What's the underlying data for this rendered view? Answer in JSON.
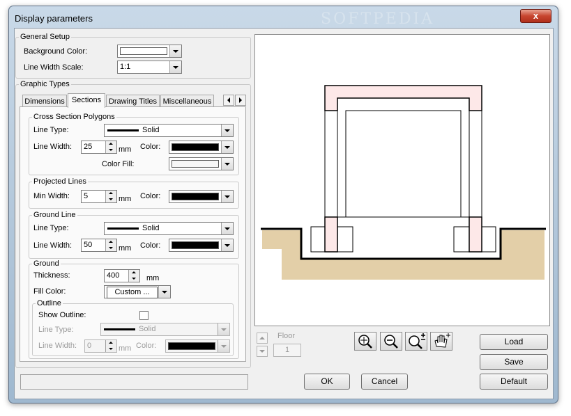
{
  "window": {
    "title": "Display parameters",
    "watermark": "SOFTPEDIA",
    "close_glyph": "x"
  },
  "general_setup": {
    "legend": "General Setup",
    "background_color_label": "Background Color:",
    "background_color_value": "#ffffff",
    "line_width_scale_label": "Line Width Scale:",
    "line_width_scale_value": "1:1"
  },
  "graphic_types": {
    "legend": "Graphic Types",
    "tabs": [
      {
        "label": "Dimensions"
      },
      {
        "label": "Sections",
        "active": true
      },
      {
        "label": "Drawing Titles"
      },
      {
        "label": "Miscellaneous"
      }
    ]
  },
  "cross_section": {
    "legend": "Cross Section Polygons",
    "line_type_label": "Line Type:",
    "line_type_value": "Solid",
    "line_width_label": "Line Width:",
    "line_width_value": "25",
    "unit": "mm",
    "color_label": "Color:",
    "color_value": "#000000",
    "color_fill_label": "Color Fill:",
    "color_fill_value": "#f7f7f7"
  },
  "projected_lines": {
    "legend": "Projected Lines",
    "min_width_label": "Min Width:",
    "min_width_value": "5",
    "unit": "mm",
    "color_label": "Color:",
    "color_value": "#000000"
  },
  "ground_line": {
    "legend": "Ground Line",
    "line_type_label": "Line Type:",
    "line_type_value": "Solid",
    "line_width_label": "Line Width:",
    "line_width_value": "50",
    "unit": "mm",
    "color_label": "Color:",
    "color_value": "#000000"
  },
  "ground": {
    "legend": "Ground",
    "thickness_label": "Thickness:",
    "thickness_value": "400",
    "unit": "mm",
    "fill_color_label": "Fill Color:",
    "fill_color_value": "Custom ...",
    "outline": {
      "legend": "Outline",
      "show_outline_label": "Show Outline:",
      "show_outline_checked": false,
      "line_type_label": "Line Type:",
      "line_type_value": "Solid",
      "line_width_label": "Line Width:",
      "line_width_value": "0",
      "unit": "mm",
      "color_label": "Color:",
      "color_value": "#000000"
    }
  },
  "preview": {
    "wall_fill": "#fde8e8",
    "ground_fill": "#e3cfa8"
  },
  "floor": {
    "label": "Floor",
    "value": "1"
  },
  "toolbar": {
    "icons": [
      "zoom-fit-icon",
      "zoom-out-icon",
      "zoom-in-out-icon",
      "pan-hand-icon"
    ]
  },
  "buttons": {
    "load": "Load",
    "save": "Save",
    "default": "Default",
    "ok": "OK",
    "cancel": "Cancel"
  }
}
